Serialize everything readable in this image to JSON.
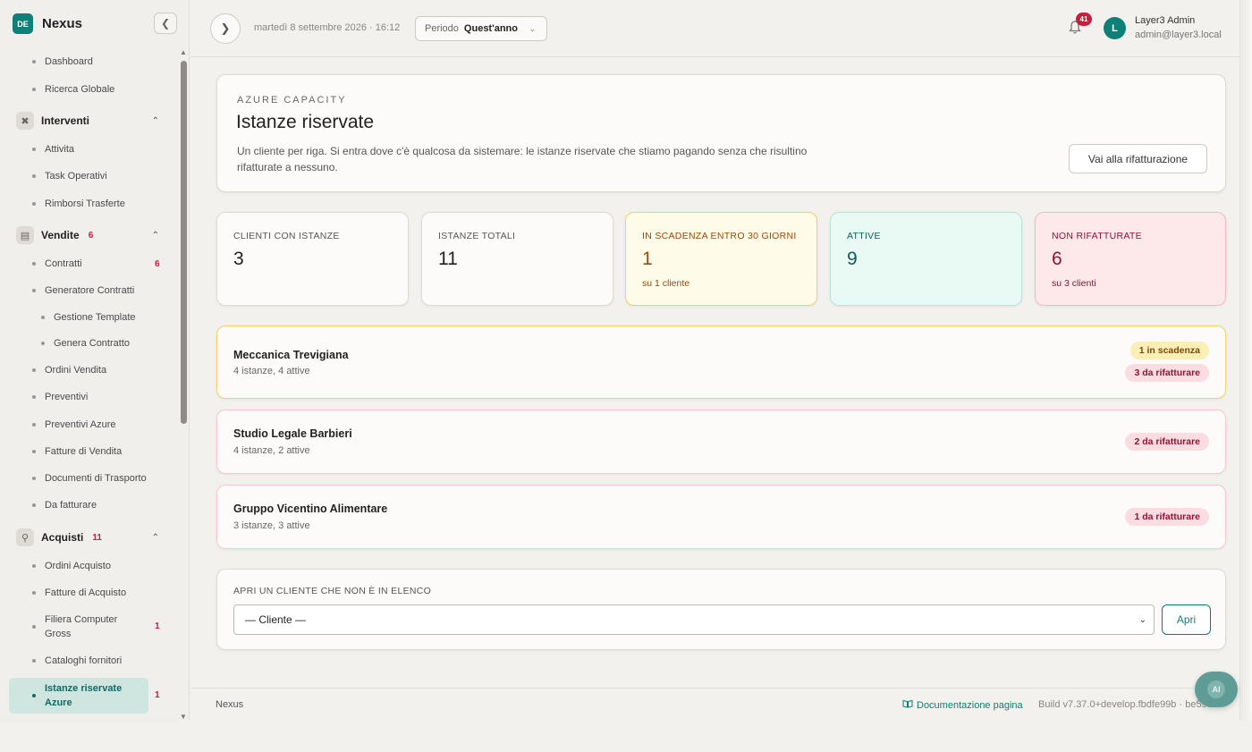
{
  "brand": {
    "logo": "DE",
    "name": "Nexus"
  },
  "sidebar": {
    "items": [
      {
        "label": "Dashboard"
      },
      {
        "label": "Ricerca Globale"
      },
      {
        "group": "Interventi",
        "icon": "tools-icon"
      },
      {
        "label": "Attivita"
      },
      {
        "label": "Task Operativi"
      },
      {
        "label": "Rimborsi Trasferte"
      },
      {
        "group": "Vendite",
        "badge": "6",
        "icon": "receipt-icon"
      },
      {
        "label": "Contratti",
        "badge": "6"
      },
      {
        "label": "Generatore Contratti"
      },
      {
        "label": "Gestione Template"
      },
      {
        "label": "Genera Contratto"
      },
      {
        "label": "Ordini Vendita"
      },
      {
        "label": "Preventivi"
      },
      {
        "label": "Preventivi Azure"
      },
      {
        "label": "Fatture di Vendita"
      },
      {
        "label": "Documenti di Trasporto"
      },
      {
        "label": "Da fatturare"
      },
      {
        "group": "Acquisti",
        "badge": "11",
        "icon": "cart-icon"
      },
      {
        "label": "Ordini Acquisto"
      },
      {
        "label": "Fatture di Acquisto"
      },
      {
        "label": "Filiera Computer Gross",
        "badge": "1"
      },
      {
        "label": "Cataloghi fornitori"
      },
      {
        "label": "Istanze riservate Azure",
        "badge": "1"
      }
    ]
  },
  "header": {
    "date": "martedì 8 settembre 2026 · 16:12",
    "period_label": "Periodo",
    "period_value": "Quest'anno",
    "notifications": "41",
    "user_initial": "L",
    "user_name": "Layer3 Admin",
    "user_email": "admin@layer3.local"
  },
  "hero": {
    "eyebrow": "AZURE CAPACITY",
    "title": "Istanze riservate",
    "description": "Un cliente per riga. Si entra dove c'è qualcosa da sistemare: le istanze riservate che stiamo pagando senza che risultino rifatturate a nessuno.",
    "button": "Vai alla rifatturazione"
  },
  "stats": [
    {
      "label": "CLIENTI CON ISTANZE",
      "value": "3",
      "sub": ""
    },
    {
      "label": "ISTANZE TOTALI",
      "value": "11",
      "sub": ""
    },
    {
      "label": "IN SCADENZA ENTRO 30 GIORNI",
      "value": "1",
      "sub": "su 1 cliente"
    },
    {
      "label": "ATTIVE",
      "value": "9",
      "sub": ""
    },
    {
      "label": "NON RIFATTURATE",
      "value": "6",
      "sub": "su 3 clienti"
    }
  ],
  "clients": [
    {
      "name": "Meccanica Trevigiana",
      "info": "4 istanze, 4 attive",
      "pill_expiring": "1 in scadenza",
      "pill_rebill": "3 da rifatturare"
    },
    {
      "name": "Studio Legale Barbieri",
      "info": "4 istanze, 2 attive",
      "pill_rebill": "2 da rifatturare"
    },
    {
      "name": "Gruppo Vicentino Alimentare",
      "info": "3 istanze, 3 attive",
      "pill_rebill": "1 da rifatturare"
    }
  ],
  "open_client": {
    "label": "APRI UN CLIENTE CHE NON È IN ELENCO",
    "select_value": "— Cliente —",
    "button": "Apri"
  },
  "footer": {
    "brand": "Nexus",
    "doc_link": "Documentazione pagina",
    "build": "Build v7.37.0+develop.fbdfe99b · be590cf"
  },
  "ai_button": "AI",
  "colors": {
    "accent": "#0f8078",
    "badge": "#c3213f",
    "warning": "#f1d36a",
    "danger": "#f3b9c0",
    "success": "#b7e4d6"
  }
}
